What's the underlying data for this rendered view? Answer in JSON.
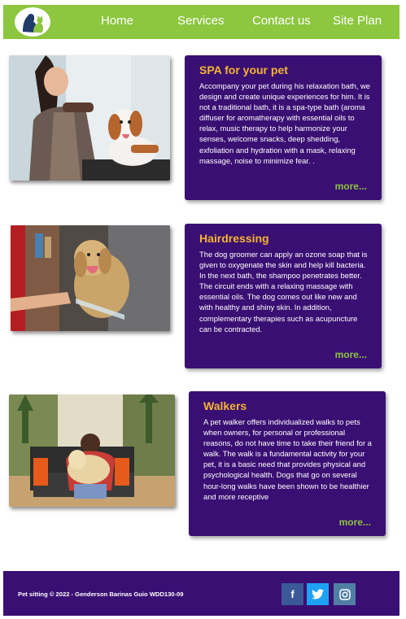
{
  "nav": {
    "links": [
      {
        "label": "Home"
      },
      {
        "label": "Services"
      },
      {
        "label": "Contact us"
      },
      {
        "label": "Site Plan"
      }
    ]
  },
  "services": [
    {
      "title": "SPA for your pet",
      "text": "Accompany your pet during his relaxation bath, we design and create unique experiences for him. It is not a traditional bath, it is a spa-type bath (aroma diffuser for aromatherapy with essential oils to relax, music therapy to help harmonize your senses, welcome snacks, deep shedding, exfoliation and hydration with a mask, relaxing massage, noise to minimize fear. .",
      "more": "more..."
    },
    {
      "title": "Hairdressing",
      "text": "The dog groomer can apply an ozone soap that is given to oxygenate the skin and help kill bacteria. In the next bath, the shampoo penetrates better. The circuit ends with a relaxing massage with essential oils. The dog comes out like new and with healthy and shiny skin. In addition, complementary therapies such as acupuncture can be contracted.",
      "more": "more..."
    },
    {
      "title": "Walkers",
      "text": "A pet walker offers individualized walks to pets when owners, for personal or professional reasons, do not have time to take their friend for a walk. The walk is a fundamental activity for your pet, it is a basic need that provides physical and psychological health. Dogs that go on several hour-long walks have been shown to be healthier and more receptive",
      "more": "more..."
    }
  ],
  "footer": {
    "text": "Pet sitting © 2022 - Genderson Barinas Guio WDD130-09",
    "social": [
      {
        "icon": "facebook-icon",
        "glyph": "f",
        "color": "#3b5998"
      },
      {
        "icon": "twitter-icon",
        "glyph": "🐦",
        "color": "#1da1f2"
      },
      {
        "icon": "instagram-icon",
        "glyph": "◎",
        "color": "#517fa4"
      }
    ]
  },
  "colors": {
    "nav": "#8dc63f",
    "card": "#3a0f73",
    "heading": "#f5b432",
    "more": "#8dc63f"
  }
}
